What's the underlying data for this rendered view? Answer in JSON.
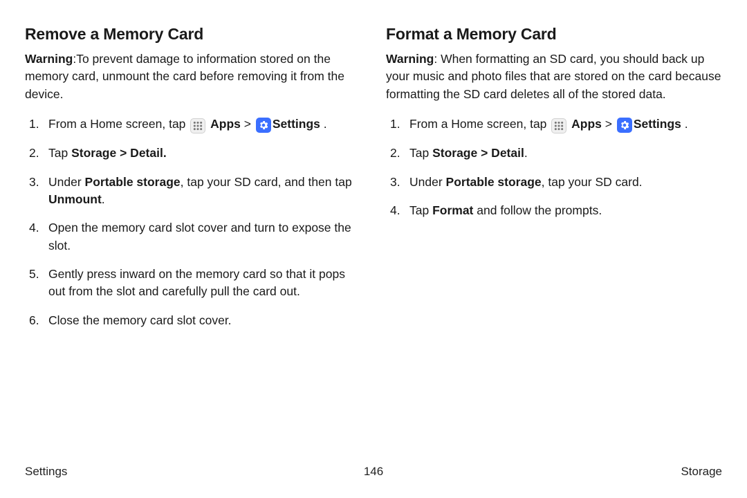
{
  "left": {
    "heading": "Remove a Memory Card",
    "warning_label": "Warning",
    "warning_text": ":To prevent damage to information stored on the memory card, unmount the card before removing it from the device.",
    "step1_a": "From a Home screen, tap ",
    "apps_label": "Apps",
    "arrow": " > ",
    "settings_label": "Settings",
    "period": " .",
    "step2_a": "Tap ",
    "step2_b": "Storage > Detail.",
    "step3_a": "Under ",
    "step3_b": "Portable storage",
    "step3_c": ", tap your SD card, and then tap ",
    "step3_d": "Unmount",
    "step3_e": ".",
    "step4": "Open the memory card slot cover and turn to expose the slot.",
    "step5": "Gently press inward on the memory card so that it pops out from the slot and carefully pull the card out.",
    "step6": "Close the memory card slot cover."
  },
  "right": {
    "heading": "Format a Memory Card",
    "warning_label": "Warning",
    "warning_text": ": When formatting an SD card, you should back up your music and photo files that are stored on the card because formatting the SD card deletes all of the stored data.",
    "step1_a": "From a Home screen, tap ",
    "apps_label": "Apps",
    "arrow": " > ",
    "settings_label": "Settings",
    "period": " .",
    "step2_a": "Tap ",
    "step2_b": "Storage > Detail",
    "step2_c": ".",
    "step3_a": "Under ",
    "step3_b": "Portable storage",
    "step3_c": ", tap your SD card.",
    "step4_a": "Tap ",
    "step4_b": "Format",
    "step4_c": " and follow the prompts."
  },
  "footer": {
    "left": "Settings",
    "center": "146",
    "right": "Storage"
  }
}
